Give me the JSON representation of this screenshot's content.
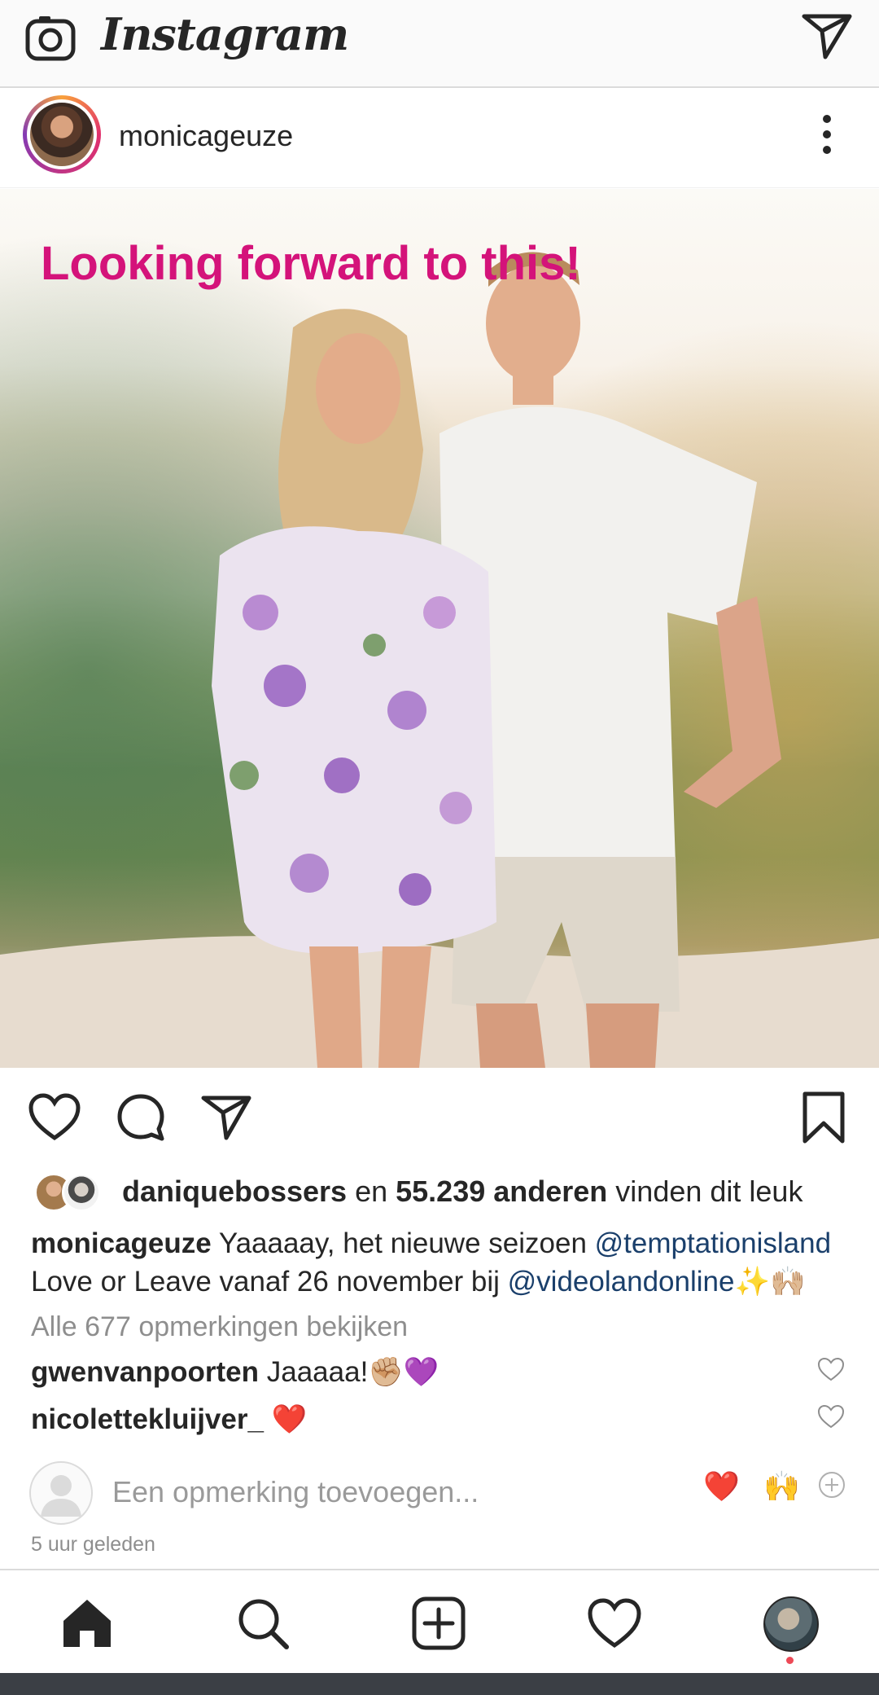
{
  "topbar": {
    "brand": "Instagram",
    "camera_icon": "camera-icon",
    "direct_icon": "paper-plane-icon"
  },
  "post": {
    "username": "monicageuze",
    "image_caption": "Looking forward to this!",
    "likes": {
      "first_user": "daniquebossers",
      "conjunction": " en ",
      "count_text": "55.239 anderen",
      "suffix": " vinden dit leuk"
    },
    "caption": {
      "username": "monicageuze",
      "text_1": " Yaaaaay, het nieuwe seizoen ",
      "mention_1": "@temptationisland",
      "text_2": " Love or Leave vanaf 26 november bij ",
      "mention_2": "@videolandonline",
      "emoji": "✨🙌🏼"
    },
    "view_comments": "Alle 677 opmerkingen bekijken",
    "comments": [
      {
        "username": "gwenvanpoorten",
        "text": " Jaaaaa!✊🏼💜"
      },
      {
        "username": "nicolettekluijver_",
        "text": " ❤️"
      }
    ],
    "add_comment_placeholder": "Een opmerking toevoegen...",
    "quick_reactions": [
      "❤️",
      "🙌"
    ],
    "timestamp": "5 uur geleden"
  },
  "navbar": {
    "items": [
      "home-icon",
      "search-icon",
      "new-post-icon",
      "activity-heart-icon",
      "profile-avatar"
    ]
  },
  "colors": {
    "caption_pink": "#d4137a",
    "mention_blue": "#1a3f6b",
    "muted_gray": "#8e8e8e",
    "notification_red": "#ed4956"
  }
}
